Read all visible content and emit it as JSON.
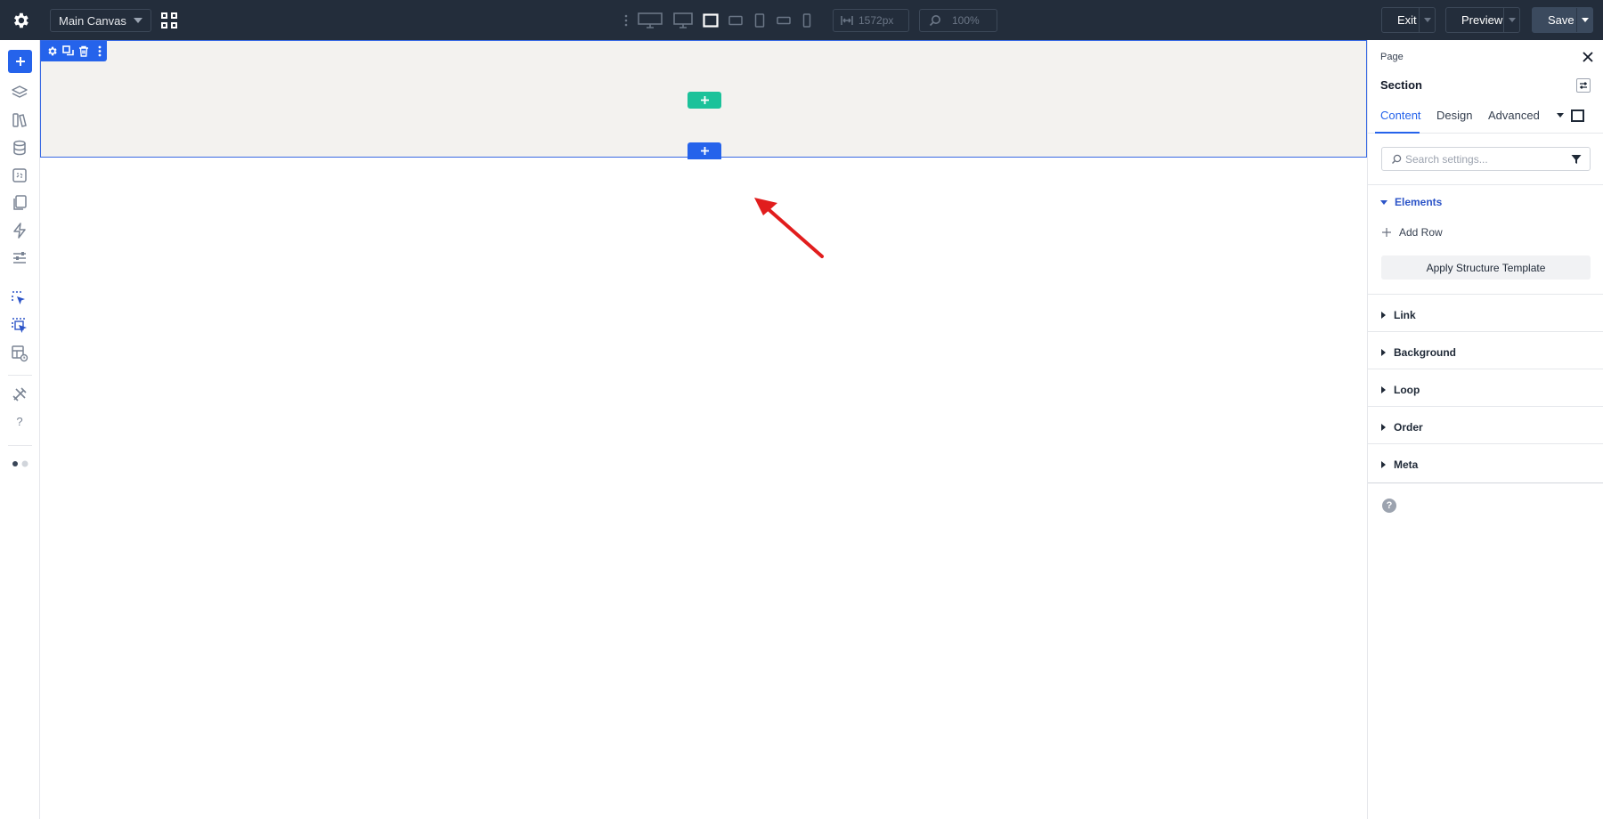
{
  "topbar": {
    "settings_icon": "gear-icon",
    "canvas_select": "Main Canvas",
    "grid_icon": "grid-icon",
    "devices": [
      "more-vertical-icon",
      "desktop-wide-icon",
      "desktop-icon",
      "laptop-icon",
      "tablet-landscape-icon",
      "tablet-portrait-icon",
      "mobile-landscape-icon",
      "mobile-portrait-icon"
    ],
    "active_device": "laptop-icon",
    "width_value": "1572px",
    "zoom_value": "100%",
    "exit_label": "Exit",
    "preview_label": "Preview",
    "save_label": "Save"
  },
  "leftbar": {
    "items": [
      "add-element-icon",
      "layers-icon",
      "library-icon",
      "database-icon",
      "component-icon",
      "pages-icon",
      "bolt-icon",
      "filters-icon",
      "select-icon",
      "multi-select-icon",
      "template-history-icon",
      "tools-icon",
      "help-icon",
      "theme-toggle-icon"
    ]
  },
  "canvas": {
    "section_toolbar": [
      "gear-icon",
      "duplicate-icon",
      "delete-icon",
      "more-vertical-icon"
    ],
    "add_inside_icon": "plus-icon",
    "add_below_icon": "plus-icon",
    "annotation": "red-arrow"
  },
  "panel": {
    "breadcrumb": "Page",
    "title": "Section",
    "tabs": [
      {
        "label": "Content",
        "active": true
      },
      {
        "label": "Design",
        "active": false
      },
      {
        "label": "Advanced",
        "active": false
      }
    ],
    "search_placeholder": "Search settings...",
    "sections": {
      "elements": "Elements",
      "add_row": "Add Row",
      "apply_template": "Apply Structure Template",
      "link": "Link",
      "background": "Background",
      "loop": "Loop",
      "order": "Order",
      "meta": "Meta"
    },
    "help": "?"
  },
  "colors": {
    "topbar_bg": "#232d3b",
    "accent_blue": "#2563eb",
    "add_green": "#1bc29a",
    "section_bg": "#f3f2ef",
    "annotation_red": "#e11d1d"
  }
}
